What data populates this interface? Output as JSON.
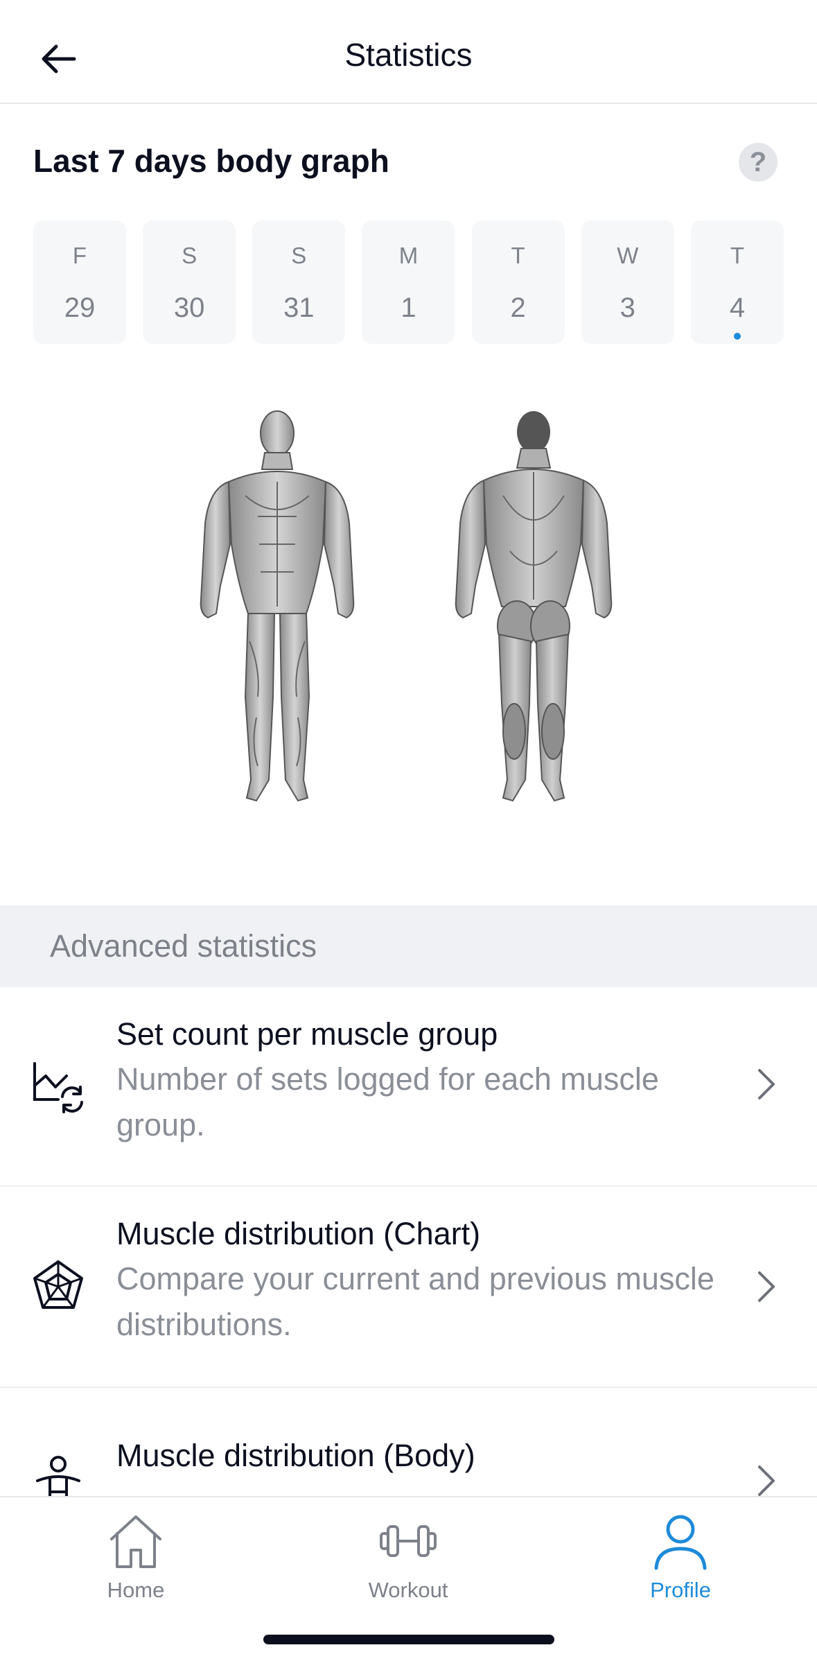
{
  "header": {
    "title": "Statistics",
    "back_icon": "arrow-left-icon"
  },
  "body_graph": {
    "title": "Last 7 days body graph",
    "help_label": "?",
    "days": [
      {
        "letter": "F",
        "number": "29",
        "has_activity": false
      },
      {
        "letter": "S",
        "number": "30",
        "has_activity": false
      },
      {
        "letter": "S",
        "number": "31",
        "has_activity": false
      },
      {
        "letter": "M",
        "number": "1",
        "has_activity": false
      },
      {
        "letter": "T",
        "number": "2",
        "has_activity": false
      },
      {
        "letter": "W",
        "number": "3",
        "has_activity": false
      },
      {
        "letter": "T",
        "number": "4",
        "has_activity": true
      }
    ],
    "figures": [
      "front-muscle-figure",
      "back-muscle-figure"
    ]
  },
  "advanced": {
    "label": "Advanced statistics",
    "items": [
      {
        "title": "Set count per muscle group",
        "description": "Number of sets logged for each muscle group.",
        "icon": "chart-refresh-icon"
      },
      {
        "title": "Muscle distribution (Chart)",
        "description": "Compare your current and previous muscle distributions.",
        "icon": "radar-chart-icon"
      },
      {
        "title": "Muscle distribution (Body)",
        "description": "",
        "icon": "person-body-icon"
      }
    ]
  },
  "nav": {
    "items": [
      {
        "label": "Home",
        "icon": "home-icon",
        "active": false
      },
      {
        "label": "Workout",
        "icon": "dumbbell-icon",
        "active": false
      },
      {
        "label": "Profile",
        "icon": "profile-icon",
        "active": true
      }
    ]
  },
  "colors": {
    "accent": "#1e8bd9",
    "text_primary": "#0b0f1e",
    "text_secondary": "#8a8e96",
    "band_bg": "#f0f1f4"
  }
}
